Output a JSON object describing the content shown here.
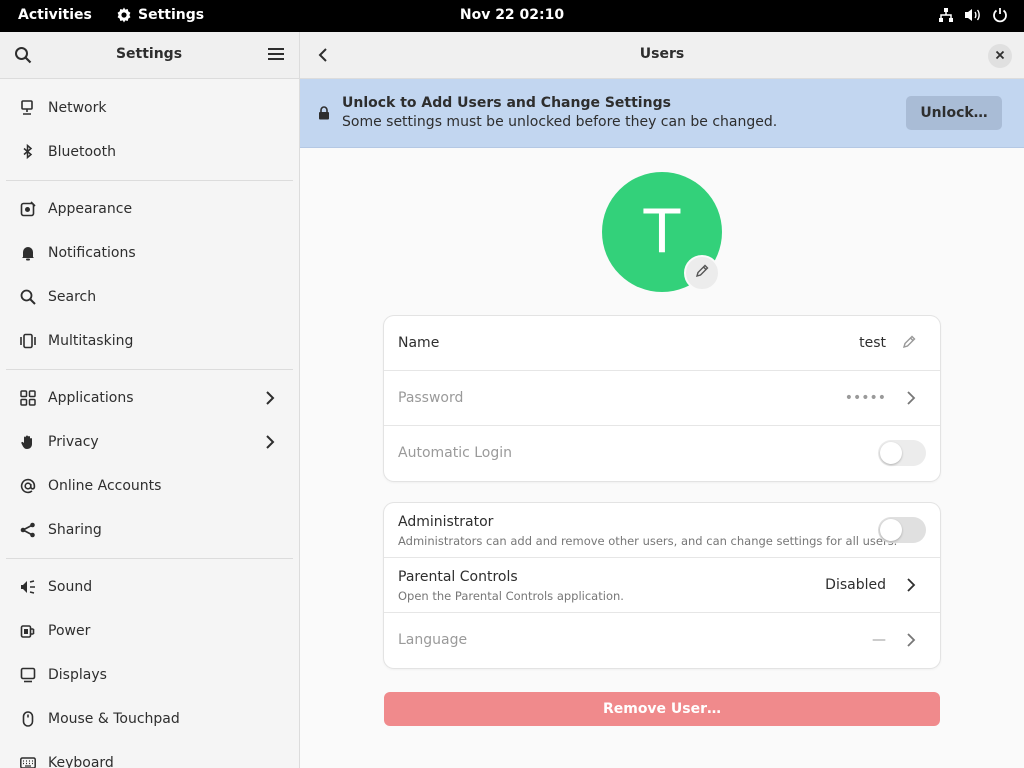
{
  "topbar": {
    "activities": "Activities",
    "app_name": "Settings",
    "clock": "Nov 22  02:10"
  },
  "sidebar": {
    "title": "Settings",
    "groups": [
      [
        {
          "label": "Network",
          "icon": "network-icon"
        },
        {
          "label": "Bluetooth",
          "icon": "bluetooth-icon"
        }
      ],
      [
        {
          "label": "Appearance",
          "icon": "appearance-icon"
        },
        {
          "label": "Notifications",
          "icon": "bell-icon"
        },
        {
          "label": "Search",
          "icon": "search-icon"
        },
        {
          "label": "Multitasking",
          "icon": "multitasking-icon"
        }
      ],
      [
        {
          "label": "Applications",
          "icon": "apps-grid-icon",
          "chevron": true
        },
        {
          "label": "Privacy",
          "icon": "hand-icon",
          "chevron": true
        },
        {
          "label": "Online Accounts",
          "icon": "at-icon"
        },
        {
          "label": "Sharing",
          "icon": "share-icon"
        }
      ],
      [
        {
          "label": "Sound",
          "icon": "speaker-icon"
        },
        {
          "label": "Power",
          "icon": "power-plug-icon"
        },
        {
          "label": "Displays",
          "icon": "display-icon"
        },
        {
          "label": "Mouse & Touchpad",
          "icon": "mouse-icon"
        },
        {
          "label": "Keyboard",
          "icon": "keyboard-icon"
        }
      ]
    ]
  },
  "main": {
    "title": "Users",
    "banner": {
      "title": "Unlock to Add Users and Change Settings",
      "subtitle": "Some settings must be unlocked before they can be changed.",
      "button": "Unlock…"
    },
    "avatar_letter": "T",
    "avatar_color": "#33d17a",
    "account": {
      "name_label": "Name",
      "name_value": "test",
      "password_label": "Password",
      "password_value": "•••••",
      "autologin_label": "Automatic Login",
      "autologin_on": false
    },
    "settings": {
      "admin_label": "Administrator",
      "admin_sub": "Administrators can add and remove other users, and can change settings for all users.",
      "admin_on": false,
      "parental_label": "Parental Controls",
      "parental_sub": "Open the Parental Controls application.",
      "parental_value": "Disabled",
      "language_label": "Language",
      "language_value": "—"
    },
    "remove_button": "Remove User…"
  }
}
